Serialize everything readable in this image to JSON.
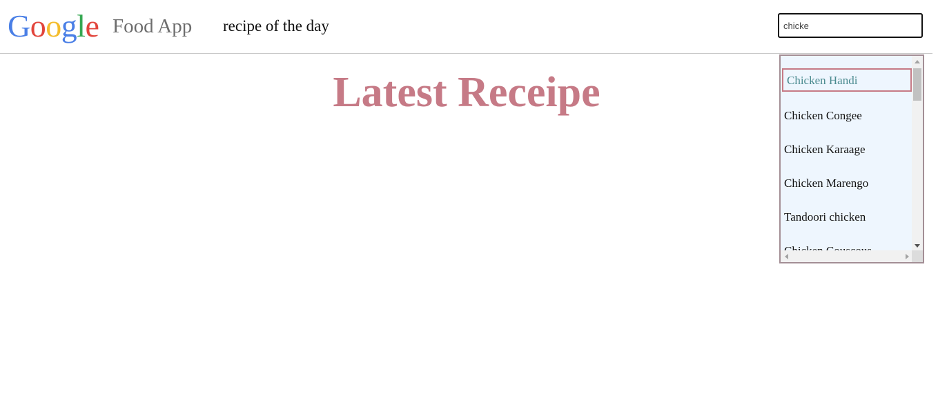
{
  "header": {
    "logo": {
      "letters": [
        {
          "char": "G",
          "color": "#4a7fe6"
        },
        {
          "char": "o",
          "color": "#e2453c"
        },
        {
          "char": "o",
          "color": "#f4bc2c"
        },
        {
          "char": "g",
          "color": "#4a7fe6"
        },
        {
          "char": "l",
          "color": "#36a852"
        },
        {
          "char": "e",
          "color": "#e2453c"
        }
      ]
    },
    "app_name": "Food App",
    "nav_link": "recipe of the day"
  },
  "search": {
    "value": "chicke"
  },
  "main": {
    "title": "Latest Receipe",
    "title_color": "#c67a86"
  },
  "autocomplete": {
    "items": [
      {
        "label": "Chicken Handi",
        "active": true
      },
      {
        "label": "Chicken Congee",
        "active": false
      },
      {
        "label": "Chicken Karaage",
        "active": false
      },
      {
        "label": "Chicken Marengo",
        "active": false
      },
      {
        "label": "Tandoori chicken",
        "active": false
      },
      {
        "label": "Chicken Couscous",
        "active": false
      }
    ],
    "active_color": "#4a8a8f",
    "active_border": "#c67a86",
    "background": "#eef6fe"
  }
}
